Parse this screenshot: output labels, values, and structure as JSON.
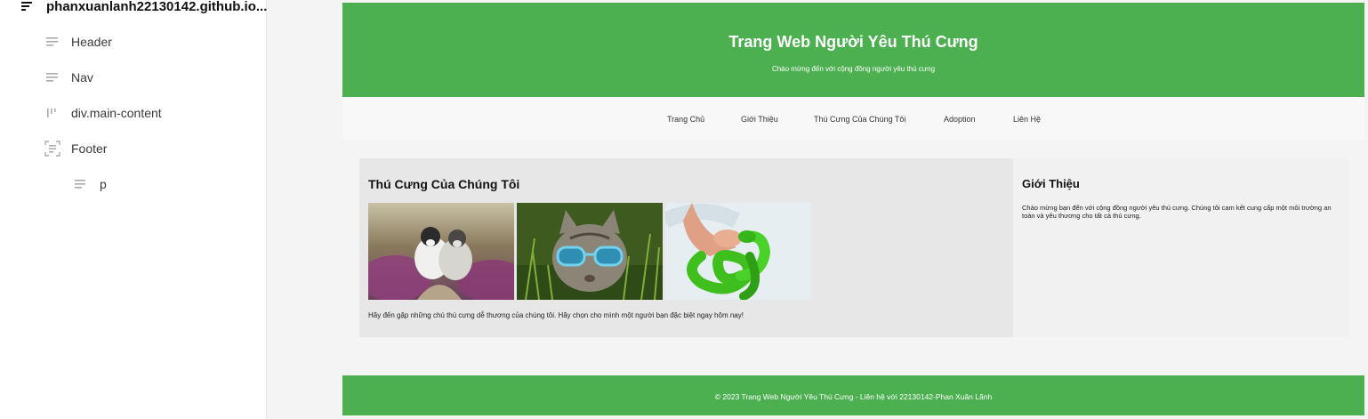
{
  "outline": {
    "root": {
      "label": "phanxuanlanh22130142.github.io...",
      "icon": "document-outline-icon"
    },
    "items": [
      {
        "label": "Header",
        "icon": "text-lines-icon"
      },
      {
        "label": "Nav",
        "icon": "text-lines-icon"
      },
      {
        "label": "div.main-content",
        "icon": "columns-icon"
      },
      {
        "label": "Footer",
        "icon": "section-frame-icon"
      },
      {
        "label": "p",
        "icon": "text-lines-icon"
      }
    ]
  },
  "site": {
    "header": {
      "title": "Trang Web Người Yêu Thú Cưng",
      "subtitle": "Chào mừng đến với cộng đồng người yêu thú cưng"
    },
    "nav": [
      "Trang Chủ",
      "Giới Thiệu",
      "Thú Cưng Của Chúng Tôi",
      "Adoption",
      "Liên Hệ"
    ],
    "pets": {
      "heading": "Thú Cưng Của Chúng Tôi",
      "images": [
        "dogs-photo",
        "cat-with-sunglasses-photo",
        "green-snake-photo"
      ],
      "text": "Hãy đến gặp những chú thú cưng dễ thương của chúng tôi. Hãy chọn cho mình một người bạn đặc biệt ngay hôm nay!"
    },
    "about": {
      "heading": "Giới Thiệu",
      "text": "Chào mừng bạn đến với cộng đồng người yêu thú cưng. Chúng tôi cam kết cung cấp một môi trường an toàn và yêu thương cho tất cả thú cưng."
    },
    "footer": {
      "text": "© 2023 Trang Web Người Yêu Thú Cưng - Liên hệ với 22130142-Phan Xuân Lãnh"
    }
  },
  "colors": {
    "brand_green": "#4caf50",
    "nav_bg": "#f8f8f8",
    "pets_bg": "#e7e7e7",
    "about_bg": "#f1f1f1"
  }
}
